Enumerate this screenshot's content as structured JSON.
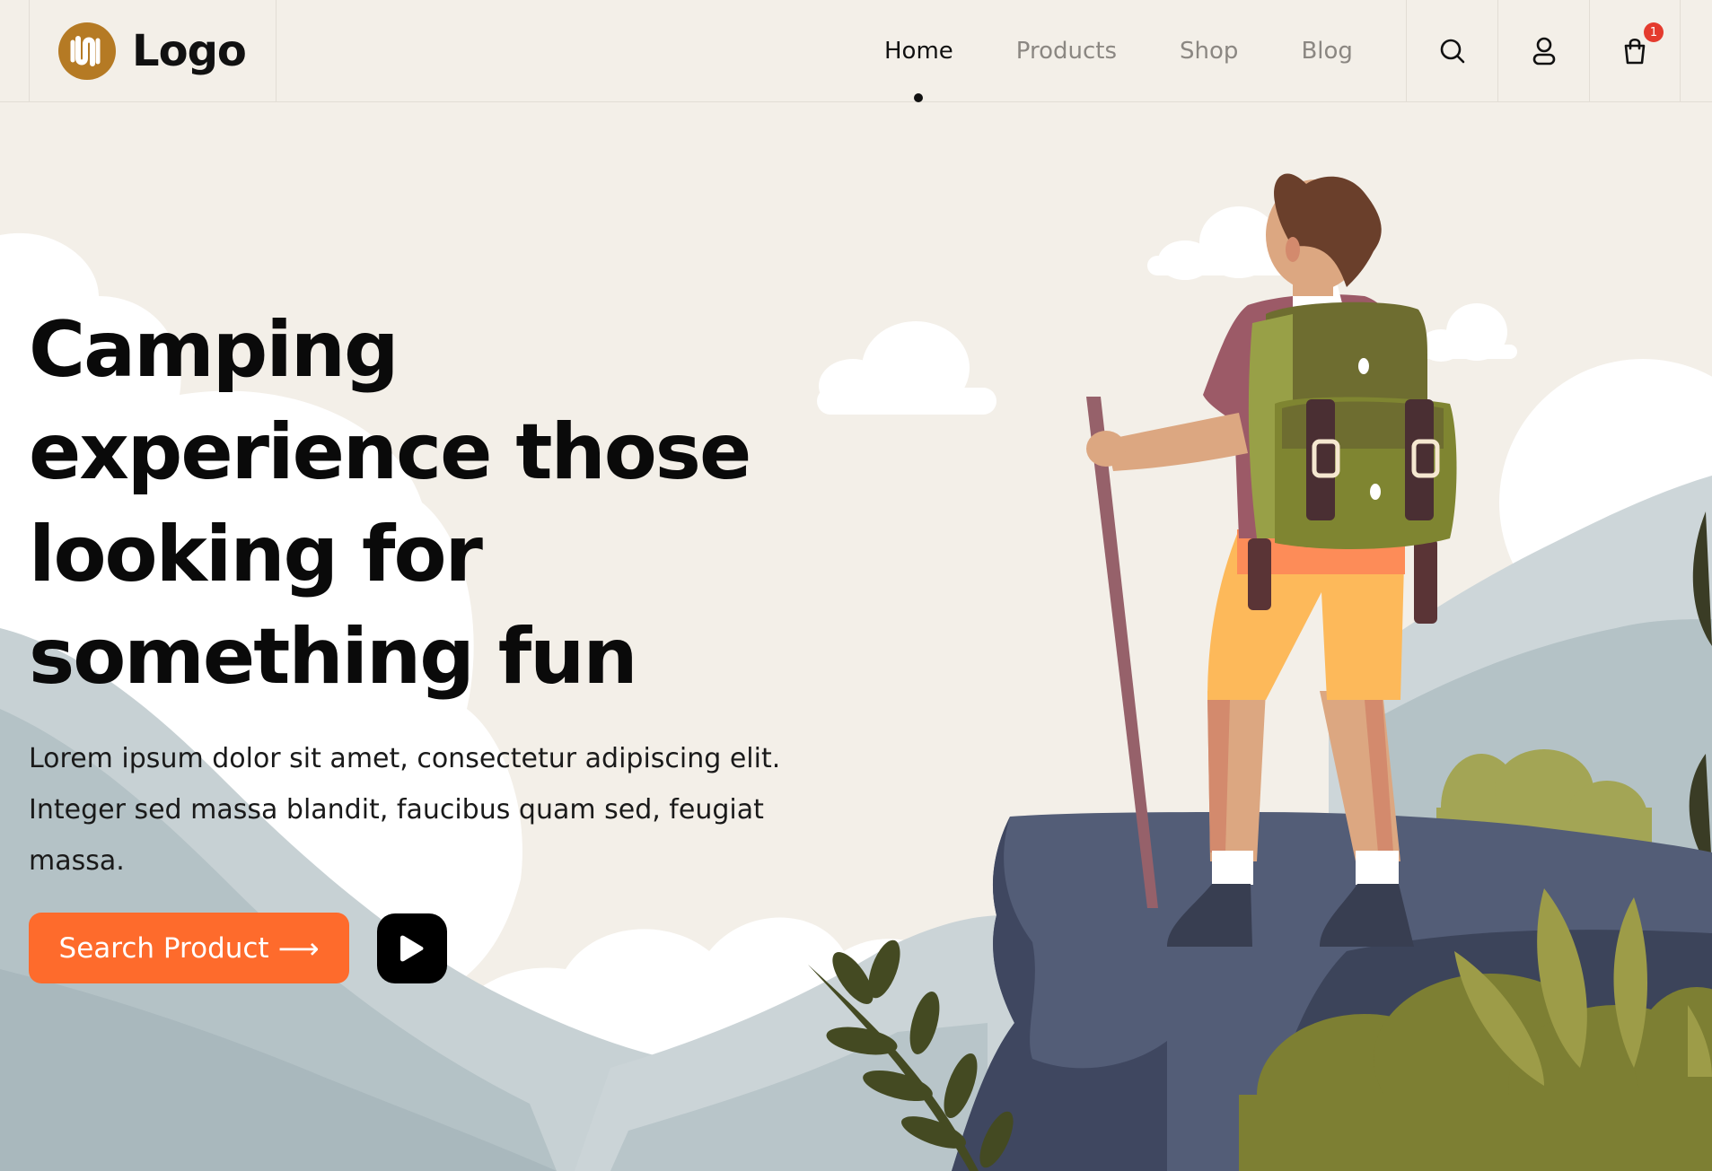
{
  "header": {
    "logo_text": "Logo",
    "nav": [
      {
        "label": "Home",
        "active": true
      },
      {
        "label": "Products",
        "active": false
      },
      {
        "label": "Shop",
        "active": false
      },
      {
        "label": "Blog",
        "active": false
      }
    ],
    "icons": [
      "search-icon",
      "user-icon",
      "cart-icon"
    ],
    "cart_count": "1"
  },
  "hero": {
    "title_lines": [
      "Camping",
      "experience those",
      "looking for",
      "something fun"
    ],
    "description_lines": [
      "Lorem ipsum dolor sit amet, consectetur adipiscing elit.",
      "Integer sed massa blandit, faucibus quam sed, feugiat",
      "massa."
    ],
    "search_button_label": "Search Product",
    "search_button_arrow": "⟶"
  },
  "colors": {
    "background": "#f3efe8",
    "accent": "#fe6b2c",
    "logo": "#b57a24",
    "badge": "#e43b2e",
    "text": "#0a0a0a"
  }
}
